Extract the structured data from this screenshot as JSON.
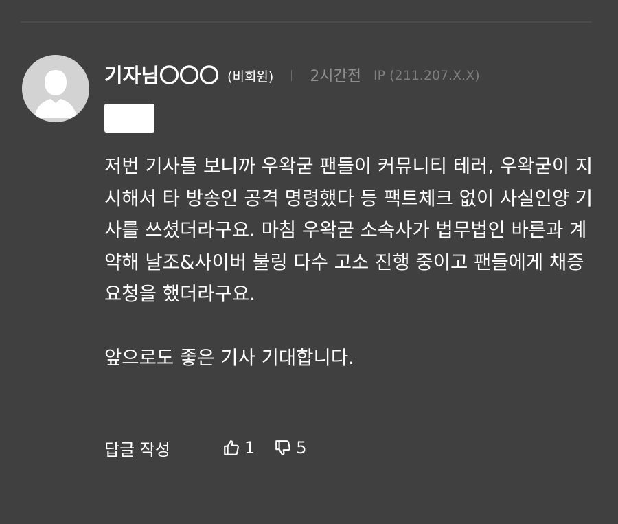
{
  "comment": {
    "author": "기자님〇〇〇",
    "member_tag": "(비회원)",
    "time": "2시간전",
    "ip": "IP (211.207.X.X)",
    "avatar_icon": "default-user-avatar-icon",
    "paragraphs": [
      "저번 기사들 보니까 우왁굳 팬들이 커뮤니티 테러, 우왁굳이 지시해서 타 방송인 공격 명령했다 등 팩트체크 없이 사실인양 기사를 쓰셨더라구요. 마침 우왁굳 소속사가 법무법인 바른과 계약해 날조&사이버 불링 다수 고소 진행 중이고 팬들에게 채증 요청을 했더라구요.",
      "앞으로도 좋은 기사 기대합니다."
    ]
  },
  "actions": {
    "reply_label": "답글 작성",
    "like_icon": "thumbs-up-icon",
    "like_count": "1",
    "dislike_icon": "thumbs-down-icon",
    "dislike_count": "5"
  },
  "colors": {
    "background": "#414040",
    "text": "#ffffff",
    "muted": "#8f8e8e",
    "avatar": "#d3d3d3"
  }
}
